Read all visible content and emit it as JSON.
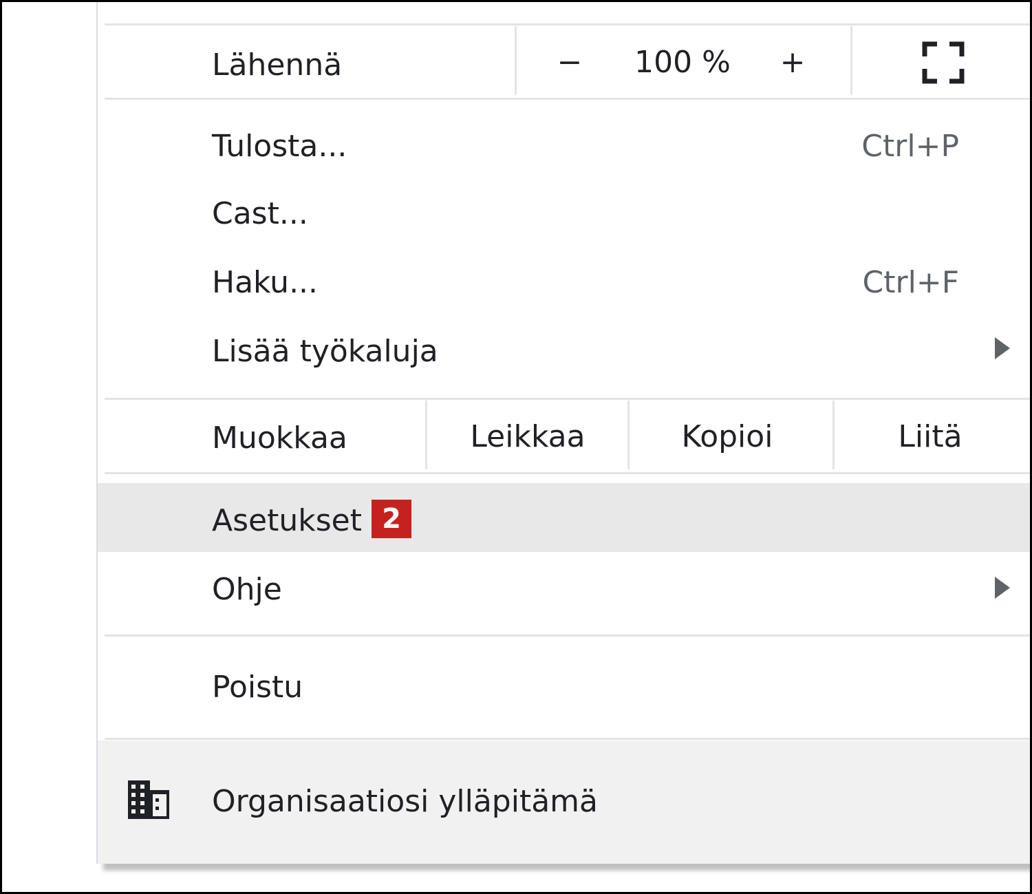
{
  "zoom": {
    "label": "Lähennä",
    "minus": "−",
    "value": "100 %",
    "plus": "+",
    "fullscreen_icon": "fullscreen-icon"
  },
  "items": {
    "print": {
      "label": "Tulosta...",
      "shortcut": "Ctrl+P"
    },
    "cast": {
      "label": "Cast..."
    },
    "find": {
      "label": "Haku...",
      "shortcut": "Ctrl+F"
    },
    "more_tools": {
      "label": "Lisää työkaluja"
    },
    "settings": {
      "label": "Asetukset",
      "badge": "2"
    },
    "help": {
      "label": "Ohje"
    },
    "exit": {
      "label": "Poistu"
    }
  },
  "edit": {
    "label": "Muokkaa",
    "cut": "Leikkaa",
    "copy": "Kopioi",
    "paste": "Liitä"
  },
  "managed": {
    "label": "Organisaatiosi ylläpitämä",
    "icon": "building-icon"
  },
  "colors": {
    "badge": "#c5221f",
    "highlight": "#e8e8e9",
    "separator": "#e4e4e4"
  }
}
